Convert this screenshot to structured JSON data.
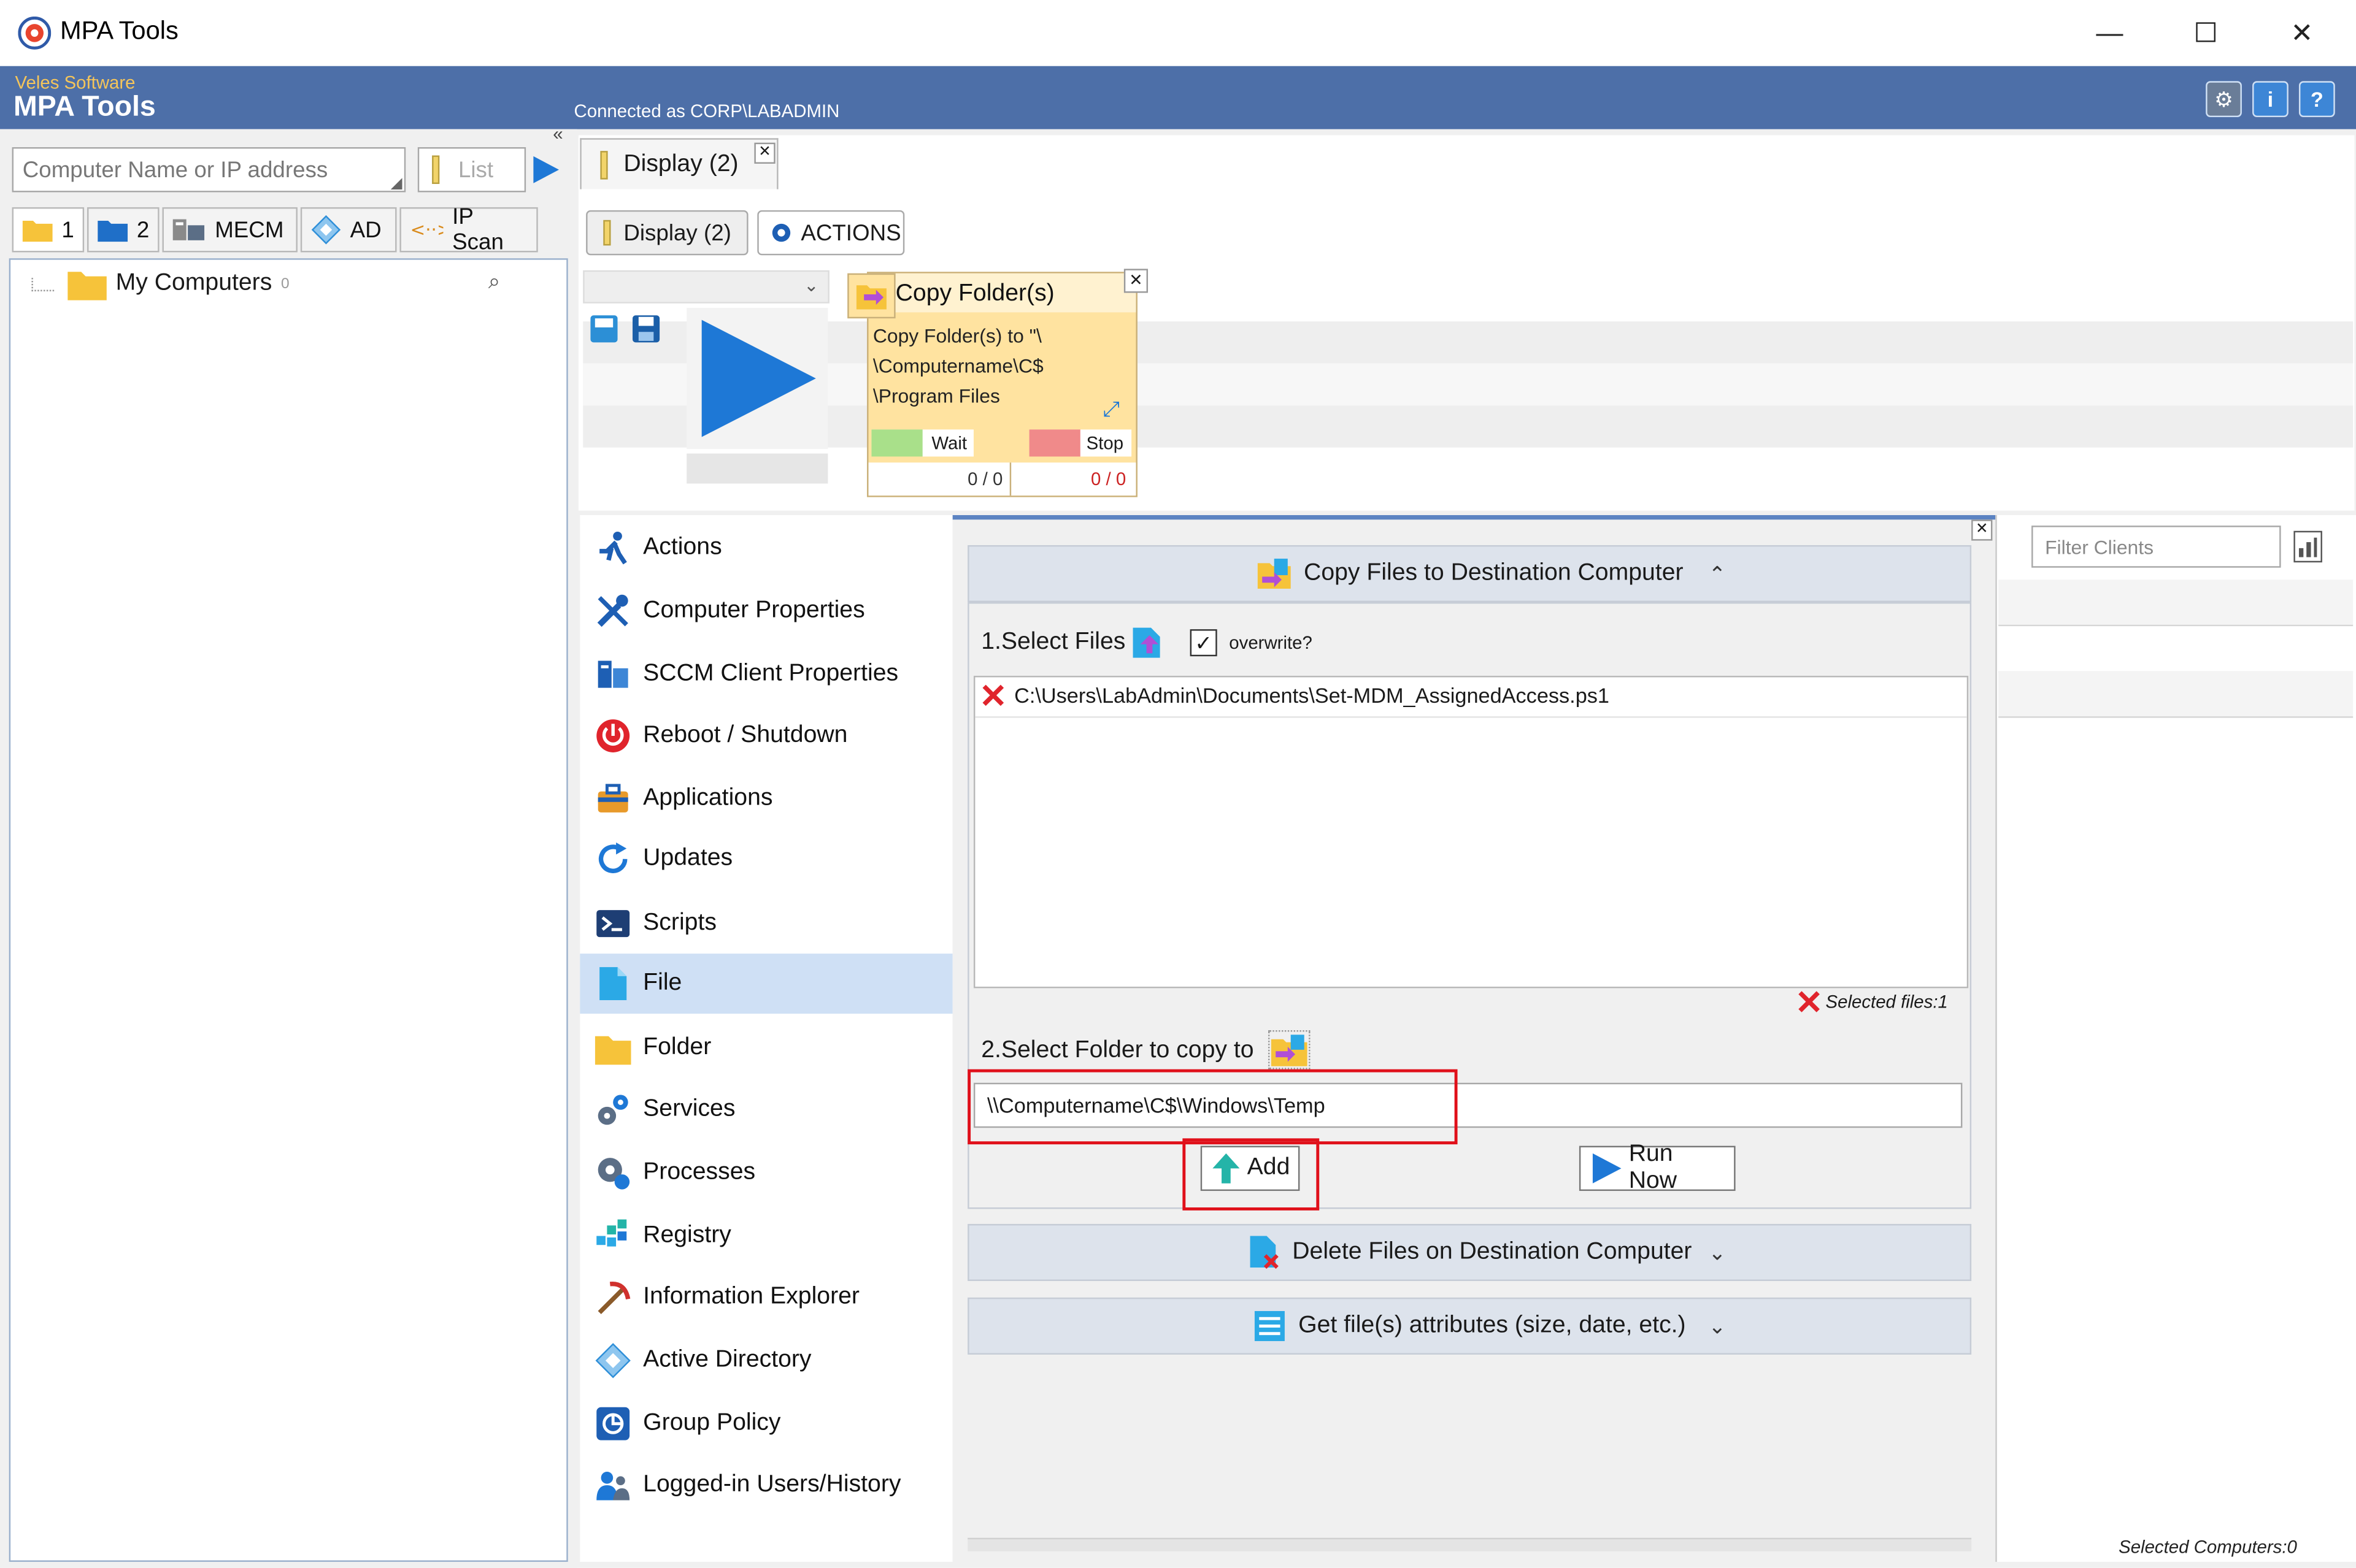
{
  "window": {
    "title": "MPA Tools",
    "minimize": "—",
    "maximize": "☐",
    "close": "✕"
  },
  "header": {
    "vendor": "Veles Software",
    "product": "MPA Tools",
    "connected": "Connected as CORP\\LABADMIN"
  },
  "left": {
    "search_placeholder": "Computer Name or IP address",
    "list_label": "List",
    "collapse": "«",
    "tabs": [
      {
        "label": "1"
      },
      {
        "label": "2"
      },
      {
        "label": "MECM"
      },
      {
        "label": "AD"
      },
      {
        "label": "IP Scan"
      }
    ],
    "tree": {
      "root_label": "My Computers",
      "root_count": "0"
    }
  },
  "display": {
    "tab_label": "Display (2)",
    "subtabs": [
      {
        "label": "Display (2)"
      },
      {
        "label": "ACTIONS"
      }
    ],
    "card": {
      "title": "Copy Folder(s)",
      "body": "Copy Folder(s) to \"\\ \\Computername\\C$ \\Program Files",
      "wait_label": "Wait",
      "stop_label": "Stop",
      "wait_count": "0 / 0",
      "stop_count": "0 / 0"
    }
  },
  "nav": {
    "items": [
      {
        "label": "Actions"
      },
      {
        "label": "Computer Properties"
      },
      {
        "label": "SCCM Client Properties"
      },
      {
        "label": "Reboot / Shutdown"
      },
      {
        "label": "Applications"
      },
      {
        "label": "Updates"
      },
      {
        "label": "Scripts"
      },
      {
        "label": "File"
      },
      {
        "label": "Folder"
      },
      {
        "label": "Services"
      },
      {
        "label": "Processes"
      },
      {
        "label": "Registry"
      },
      {
        "label": "Information Explorer"
      },
      {
        "label": "Active Directory"
      },
      {
        "label": "Group Policy"
      },
      {
        "label": "Logged-in Users/History"
      }
    ]
  },
  "main": {
    "copy_section": {
      "title": "Copy Files to Destination Computer",
      "select_files_label": "1.Select Files",
      "overwrite_label": "overwrite?",
      "files": [
        "C:\\Users\\LabAdmin\\Documents\\Set-MDM_AssignedAccess.ps1"
      ],
      "selected_files": "Selected files:1",
      "select_folder_label": "2.Select Folder to copy to",
      "destination_value": "\\\\Computername\\C$\\Windows\\Temp",
      "add_label": "Add",
      "run_label": "Run Now"
    },
    "delete_section": {
      "title": "Delete Files on Destination Computer"
    },
    "attrib_section": {
      "title": "Get file(s) attributes (size, date, etc.)"
    }
  },
  "right": {
    "filter_placeholder": "Filter Clients",
    "selected_computers": "Selected Computers:0"
  },
  "colors": {
    "header": "#4d6fa8",
    "accent": "#1e78d6",
    "highlight": "#e0101a",
    "card": "#ffe3a0"
  }
}
